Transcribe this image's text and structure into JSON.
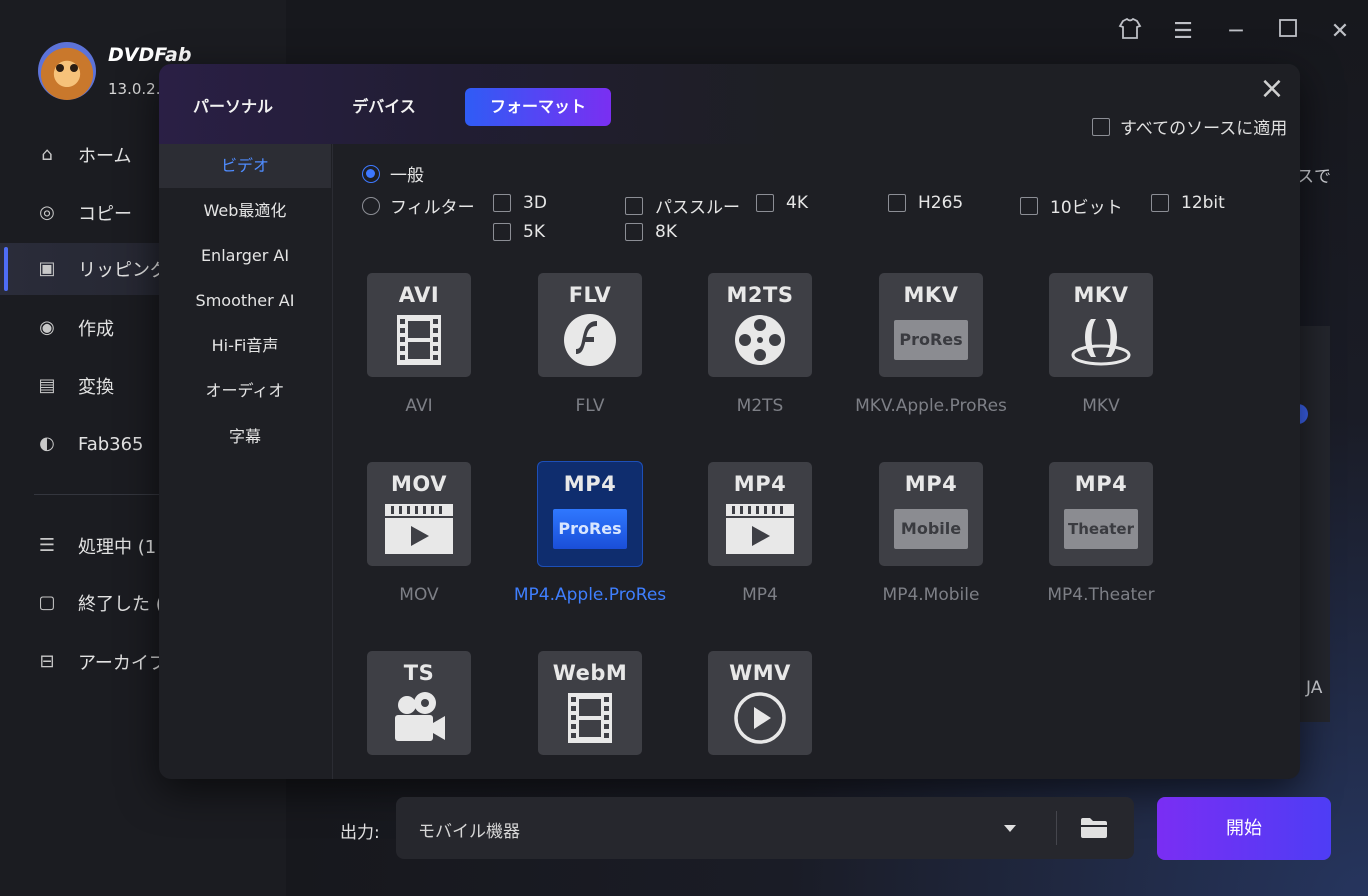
{
  "app": {
    "brand": "DVDFab",
    "version": "13.0.2."
  },
  "sidebar": {
    "items": [
      {
        "label": "ホーム",
        "icon": "home-icon"
      },
      {
        "label": "コピー",
        "icon": "copy-disc-icon"
      },
      {
        "label": "リッピング",
        "icon": "ripping-icon",
        "active": true
      },
      {
        "label": "作成",
        "icon": "create-disc-icon"
      },
      {
        "label": "変換",
        "icon": "film-convert-icon"
      },
      {
        "label": "Fab365",
        "icon": "fab365-icon"
      }
    ],
    "bottom_items": [
      {
        "label": "処理中 (1",
        "icon": "processing-list-icon"
      },
      {
        "label": "終了した (",
        "icon": "finished-clipboard-icon"
      },
      {
        "label": "アーカイブ済",
        "icon": "archive-box-icon"
      }
    ]
  },
  "background": {
    "fragment_right": "スで",
    "fragment_ja": "JA"
  },
  "modal": {
    "tabs": [
      "パーソナル",
      "デバイス",
      "フォーマット"
    ],
    "active_tab": "フォーマット",
    "apply_all_label": "すべてのソースに適用",
    "subnav": [
      "ビデオ",
      "Web最適化",
      "Enlarger AI",
      "Smoother AI",
      "Hi-Fi音声",
      "オーディオ",
      "字幕"
    ],
    "subnav_active": "ビデオ",
    "radio_general": "一般",
    "radio_filter": "フィルター",
    "filters": [
      "3D",
      "パススルー",
      "4K",
      "H265",
      "10ビット",
      "12bit",
      "5K",
      "8K"
    ],
    "formats": [
      {
        "tile": "AVI",
        "label": "AVI",
        "glyph": "film-strip-icon"
      },
      {
        "tile": "FLV",
        "label": "FLV",
        "glyph": "flash-icon"
      },
      {
        "tile": "M2TS",
        "label": "M2TS",
        "glyph": "film-reel-icon"
      },
      {
        "tile": "MKV",
        "label": "MKV.Apple.ProRes",
        "badge": "ProRes"
      },
      {
        "tile": "MKV",
        "label": "MKV",
        "glyph": "matroska-icon"
      },
      {
        "tile": "MOV",
        "label": "MOV",
        "glyph": "clapper-play-icon"
      },
      {
        "tile": "MP4",
        "label": "MP4.Apple.ProRes",
        "badge": "ProRes",
        "selected": true
      },
      {
        "tile": "MP4",
        "label": "MP4",
        "glyph": "clapper-play-icon"
      },
      {
        "tile": "MP4",
        "label": "MP4.Mobile",
        "badge": "Mobile"
      },
      {
        "tile": "MP4",
        "label": "MP4.Theater",
        "badge": "Theater"
      },
      {
        "tile": "TS",
        "label": "TS",
        "glyph": "video-camera-icon"
      },
      {
        "tile": "WebM",
        "label": "WebM",
        "glyph": "film-strip-icon"
      },
      {
        "tile": "WMV",
        "label": "WMV",
        "glyph": "play-circle-icon"
      }
    ]
  },
  "output": {
    "label": "出力:",
    "value": "モバイル機器"
  },
  "start_button": "開始",
  "colors": {
    "accent_blue": "#3d78ff",
    "accent_purple": "#7a2ef3"
  }
}
